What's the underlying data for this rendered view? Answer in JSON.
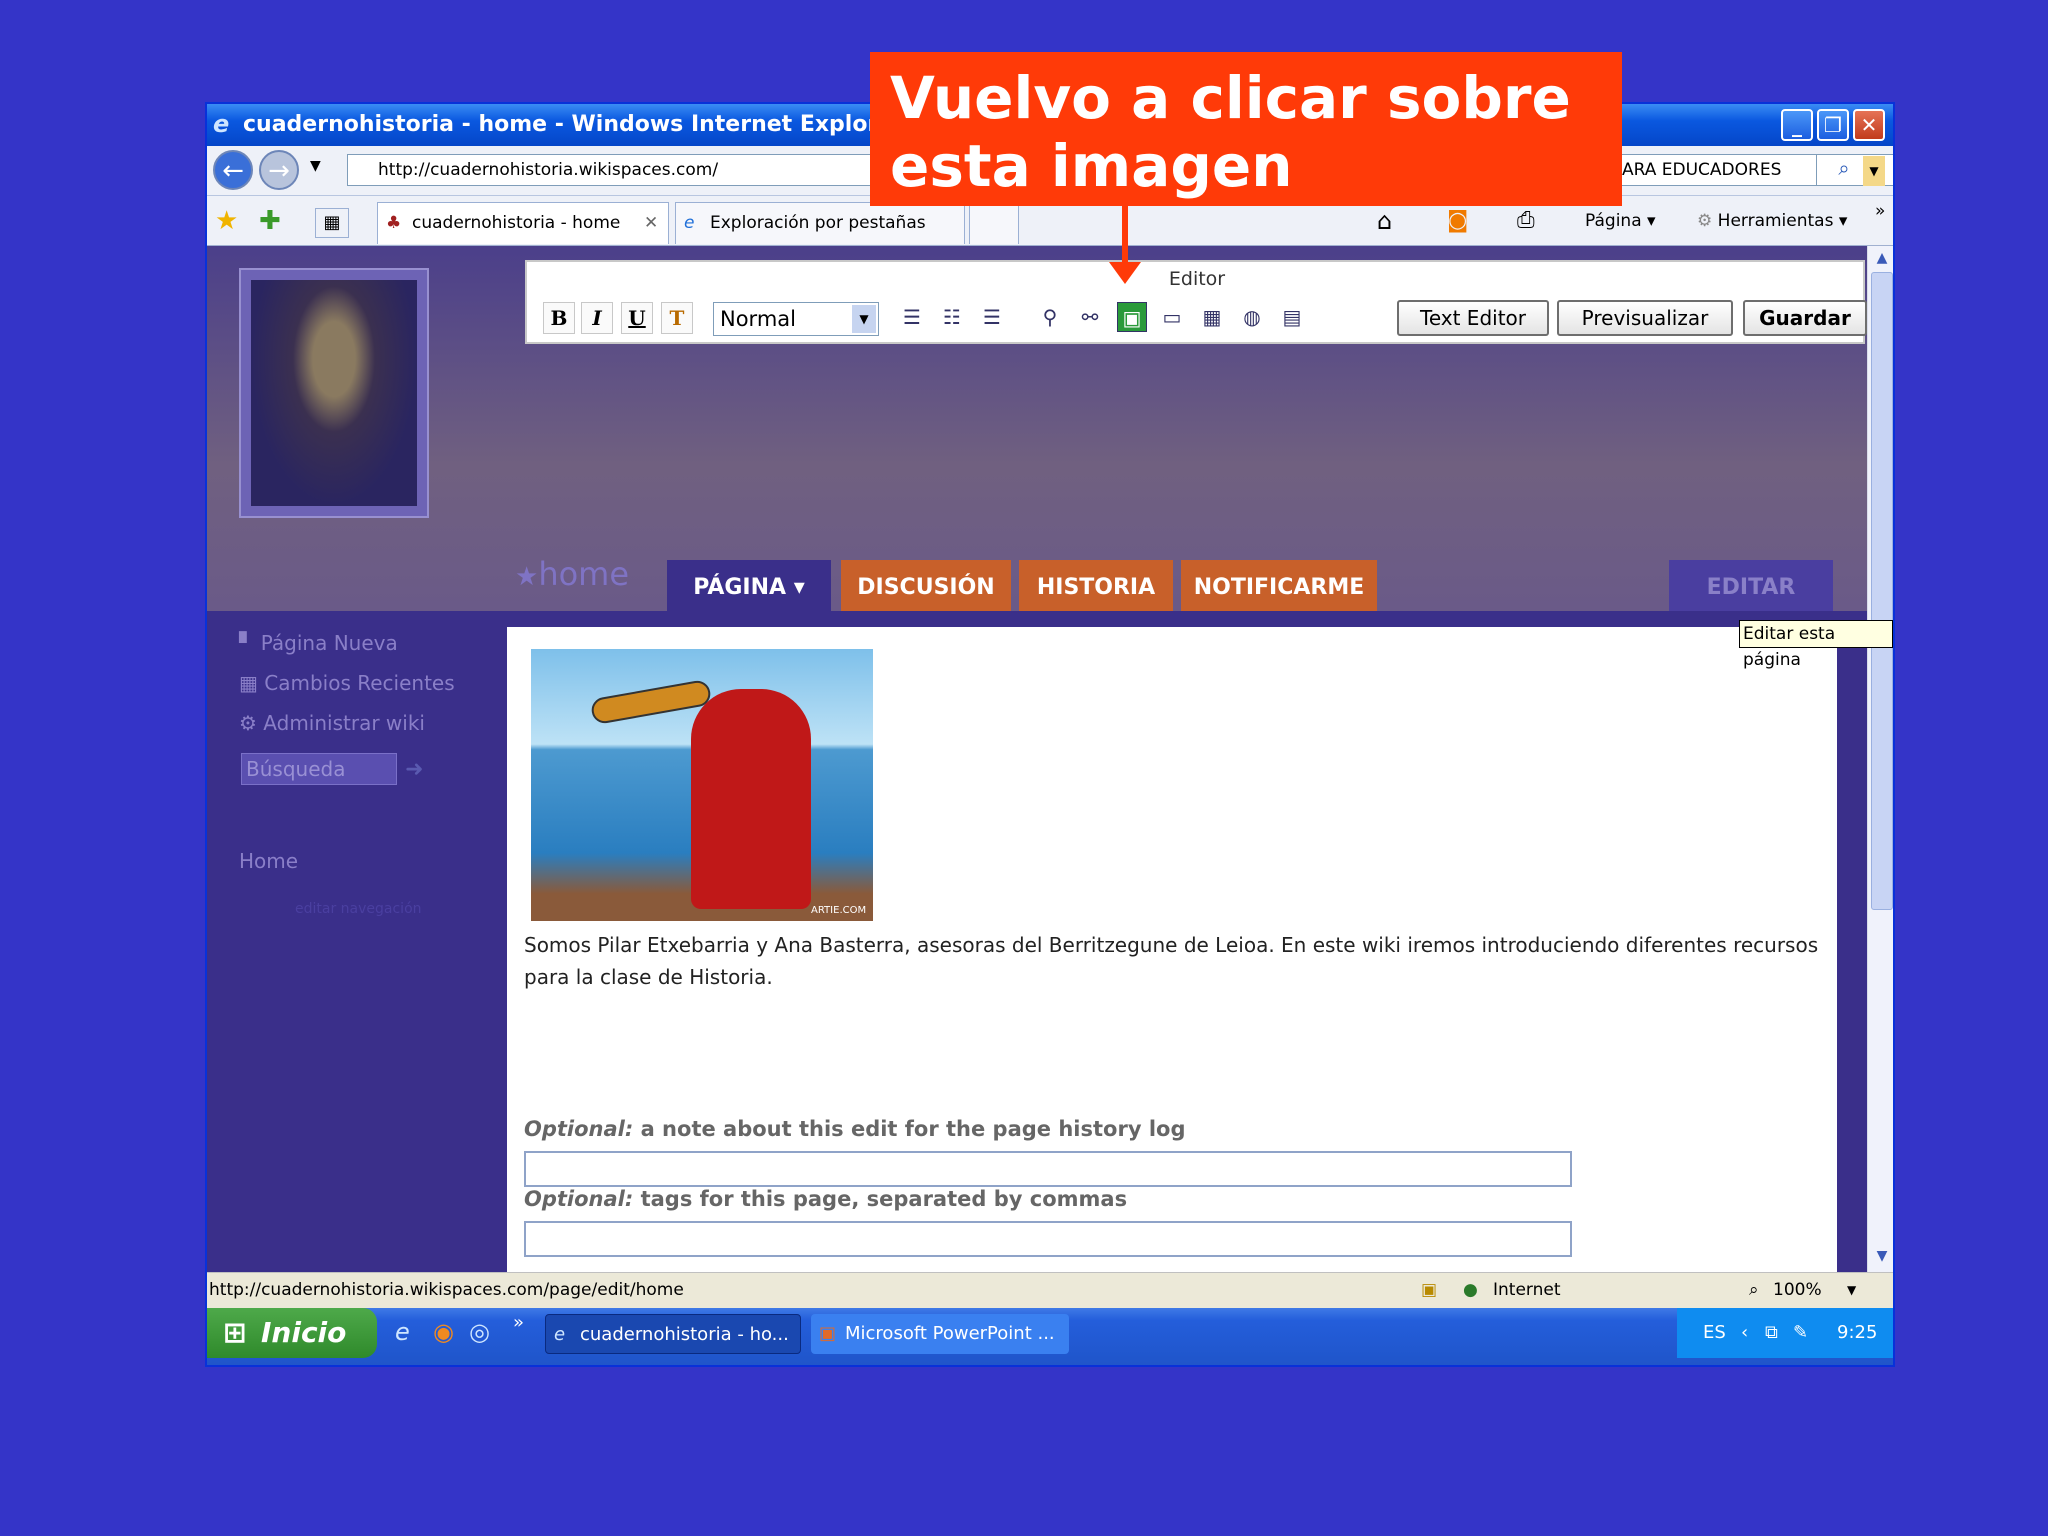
{
  "window": {
    "title": "cuadernohistoria - home - Windows Internet Explorer"
  },
  "browser": {
    "address": "http://cuadernohistoria.wikispaces.com/",
    "search_tail": "ARA EDUCADORES",
    "tabs": [
      "cuadernohistoria - home",
      "Exploración por pestañas"
    ],
    "tools": {
      "pagina": "Página",
      "herramientas": "Herramientas"
    }
  },
  "editor": {
    "title": "Editor",
    "style_select": "Normal",
    "buttons": {
      "text_editor": "Text Editor",
      "preview": "Previsualizar",
      "save": "Guardar"
    }
  },
  "wiki": {
    "page_name": "home",
    "nav_tabs": [
      "PÁGINA",
      "DISCUSIÓN",
      "HISTORIA",
      "NOTIFICARME"
    ],
    "edit": "EDITAR",
    "tooltip": "Editar esta página",
    "sidebar": {
      "items": [
        "Página Nueva",
        "Cambios Recientes",
        "Administrar wiki"
      ],
      "search_placeholder": "Búsqueda",
      "home_link": "Home",
      "edit_nav": "editar navegación"
    },
    "body_text": "Somos Pilar Etxebarria y Ana Basterra, asesoras del Berritzegune de Leioa. En este wiki iremos introduciendo diferentes recursos para la clase de Historia.",
    "image_credit": "ARTIE.COM",
    "optional_label": "Optional:",
    "note_label": "a note about this edit for the page history log",
    "tags_label": "tags for this page, separated by commas"
  },
  "status": {
    "url": "http://cuadernohistoria.wikispaces.com/page/edit/home",
    "zone": "Internet",
    "zoom": "100%"
  },
  "taskbar": {
    "start": "Inicio",
    "tasks": [
      "cuadernohistoria - ho...",
      "Microsoft PowerPoint ..."
    ],
    "lang": "ES",
    "clock": "9:25"
  },
  "callout": {
    "line1": "Vuelvo a clicar sobre",
    "line2": "esta imagen"
  }
}
